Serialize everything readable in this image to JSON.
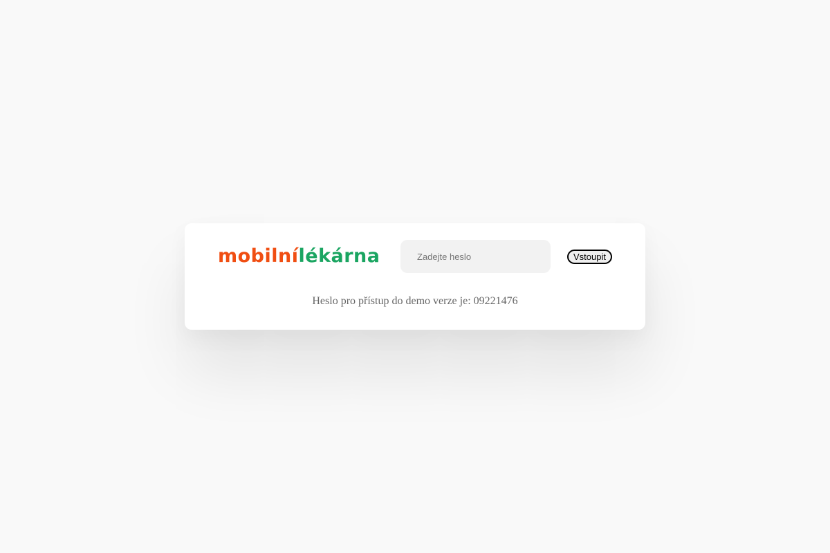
{
  "login": {
    "logo": {
      "part1": "mobilní",
      "part2": "lékárna",
      "color_part1": "#f04e12",
      "color_part2": "#1aa561"
    },
    "password_input": {
      "placeholder": "Zadejte heslo",
      "value": ""
    },
    "submit_label": "Vstoupit",
    "hint": "Heslo pro přístup do demo verze je: 09221476"
  }
}
